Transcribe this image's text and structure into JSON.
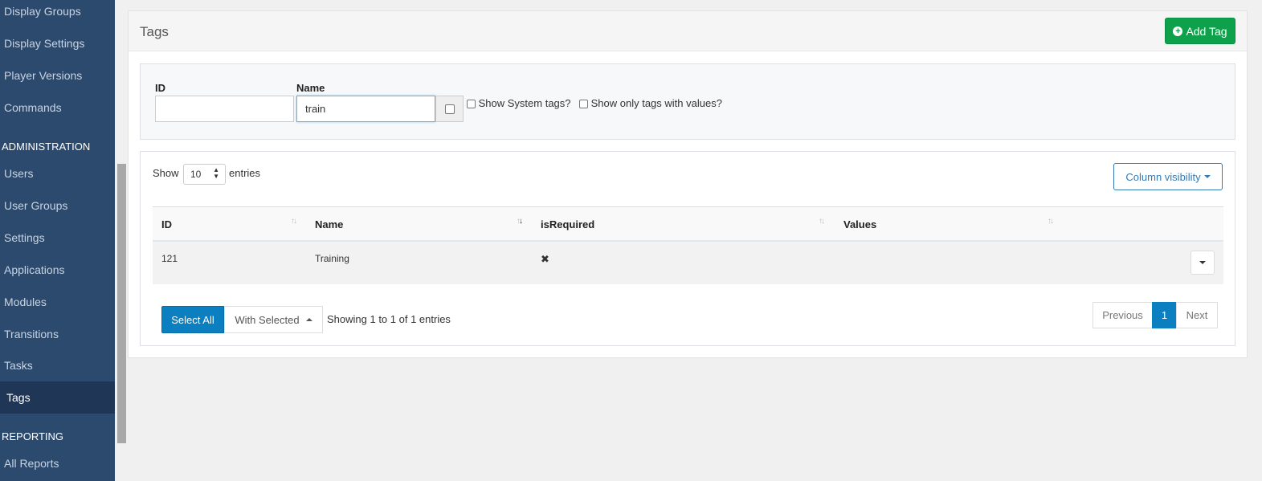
{
  "sidebar": {
    "items": [
      {
        "label": "Display Groups"
      },
      {
        "label": "Display Settings"
      },
      {
        "label": "Player Versions"
      },
      {
        "label": "Commands"
      },
      {
        "label": "Users"
      },
      {
        "label": "User Groups"
      },
      {
        "label": "Settings"
      },
      {
        "label": "Applications"
      },
      {
        "label": "Modules"
      },
      {
        "label": "Transitions"
      },
      {
        "label": "Tasks"
      },
      {
        "label": "Tags"
      },
      {
        "label": "All Reports"
      }
    ],
    "headers": {
      "administration": "ADMINISTRATION",
      "reporting": "REPORTING"
    },
    "active": "Tags"
  },
  "page": {
    "title": "Tags",
    "add_button": "Add Tag"
  },
  "filter": {
    "id_label": "ID",
    "id_value": "",
    "name_label": "Name",
    "name_value": "train",
    "system_tags_label": "Show System tags?",
    "only_values_label": "Show only tags with values?"
  },
  "table": {
    "show_label": "Show",
    "page_length": "10",
    "entries_label": "entries",
    "column_visibility": "Column visibility",
    "columns": [
      "ID",
      "Name",
      "isRequired",
      "Values"
    ],
    "rows": [
      {
        "id": "121",
        "name": "Training",
        "isRequired": "✖",
        "values": ""
      }
    ],
    "select_all": "Select All",
    "with_selected": "With Selected",
    "info": "Showing 1 to 1 of 1 entries",
    "pagination": {
      "previous": "Previous",
      "current": "1",
      "next": "Next"
    }
  },
  "colors": {
    "sidebar": "#2c4a6e",
    "accent": "#0b7fc0",
    "add": "#0ea14b"
  }
}
